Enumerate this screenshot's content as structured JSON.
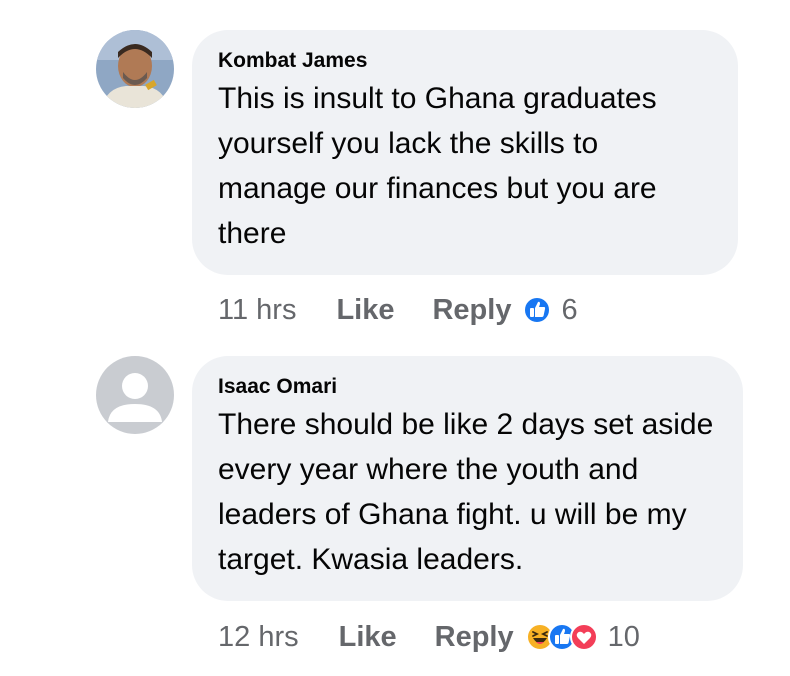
{
  "comments": [
    {
      "author": "Kombat James",
      "text": "This is insult to Ghana graduates yourself you lack the skills to manage our finances but you are there",
      "time": "11 hrs",
      "like_label": "Like",
      "reply_label": "Reply",
      "reactions": [
        "like-reaction-icon"
      ],
      "reaction_count": "6"
    },
    {
      "author": "Isaac Omari",
      "text": "There should be like 2 days set aside every year where the youth and leaders of Ghana fight.  u will be my target. Kwasia leaders.",
      "time": "12 hrs",
      "like_label": "Like",
      "reply_label": "Reply",
      "reactions": [
        "haha-reaction-icon",
        "like-reaction-icon",
        "love-reaction-icon"
      ],
      "reaction_count": "10"
    }
  ],
  "colors": {
    "bubble": "#f0f2f5",
    "secondary_text": "#65676b",
    "like_blue": "#1877f2",
    "love_red": "#f33e58",
    "haha_yellow": "#f7b125"
  }
}
